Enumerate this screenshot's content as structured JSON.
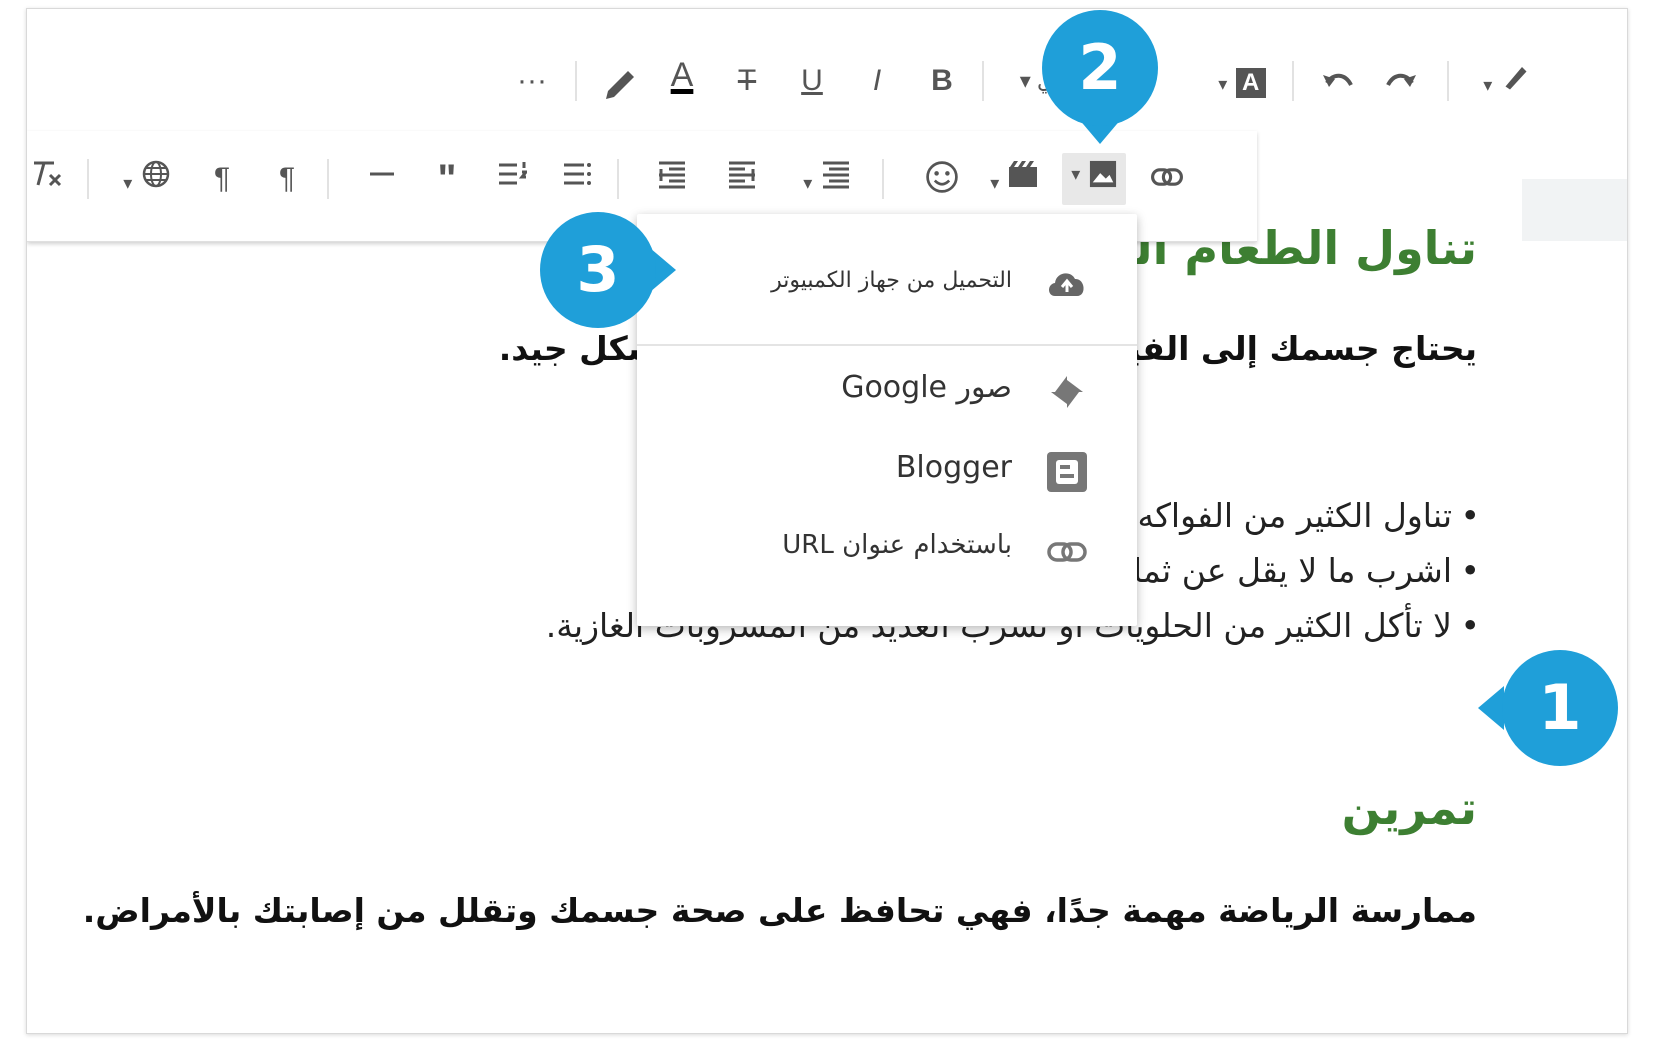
{
  "toolbar_top": {
    "more_label": "···",
    "bold_label": "B",
    "italic_label": "I",
    "underline_label": "U",
    "strike_label": "T",
    "text_color_label": "A",
    "font_size_label": "ي",
    "highlight_label": "A",
    "icons": [
      "pencil-icon",
      "edit-mode-icon",
      "undo-icon",
      "redo-icon",
      "more-icon"
    ]
  },
  "toolbar_second": {
    "icons": [
      "link-icon",
      "image-icon",
      "video-icon",
      "emoji-icon",
      "align-icon",
      "ltr-icon",
      "rtl-icon",
      "numbered-list-icon",
      "bulleted-list-icon",
      "quote-icon",
      "hr-icon",
      "pilcrow-icon",
      "globe-icon",
      "clear-format-icon"
    ]
  },
  "menu": {
    "upload_label": "التحميل من جهاز الكمبيوتر",
    "google_photos_label": "صور Google",
    "blogger_label": "Blogger",
    "url_label": "باستخدام عنوان URL"
  },
  "content": {
    "heading1": "تناول الطعام الصحي",
    "para1": "يحتاج جسمك إلى الفيتامينات والمعادن لكي يعمل بشكل جيد.",
    "bullets": [
      "تناول الكثير من الفواكه والخضروات.",
      "اشرب ما لا يقل عن ثمانية أكواب من الماء يوميًا.",
      "لا تأكل الكثير من الحلويات أو تشرب العديد من المشروبات الغازية."
    ],
    "heading2": "تمرين",
    "para2": "ممارسة الرياضة مهمة جدًا، فهي تحافظ على صحة جسمك وتقلل من إصابتك بالأمراض."
  },
  "callouts": [
    "1",
    "2",
    "3"
  ],
  "colors": {
    "accent": "#1f9fd9",
    "heading": "#3d7f32"
  }
}
